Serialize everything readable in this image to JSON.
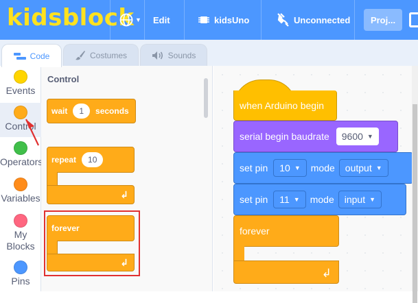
{
  "menubar": {
    "logo": "kidsblock",
    "edit_label": "Edit",
    "device_label": "kidsUno",
    "connection_label": "Unconnected",
    "project_label": "Proj..."
  },
  "tabs": [
    {
      "label": "Code"
    },
    {
      "label": "Costumes"
    },
    {
      "label": "Sounds"
    }
  ],
  "categories": [
    {
      "label": "Events",
      "color": "#ffd500"
    },
    {
      "label": "Control",
      "color": "#ffab19"
    },
    {
      "label": "Operators",
      "color": "#40bf4a"
    },
    {
      "label": "Variables",
      "color": "#ff8c1a"
    },
    {
      "label": "My Blocks",
      "color": "#ff6680"
    },
    {
      "label": "Pins",
      "color": "#4c97ff"
    }
  ],
  "palette": {
    "title": "Control",
    "wait": {
      "label": "wait",
      "value": "1",
      "suffix": "seconds"
    },
    "repeat": {
      "label": "repeat",
      "value": "10"
    },
    "forever": {
      "label": "forever"
    }
  },
  "script": {
    "hat": "when Arduino begin",
    "serial": {
      "label": "serial begin baudrate",
      "value": "9600"
    },
    "pin1": {
      "label": "set pin",
      "pin": "10",
      "mode_label": "mode",
      "mode": "output"
    },
    "pin2": {
      "label": "set pin",
      "pin": "11",
      "mode_label": "mode",
      "mode": "input"
    },
    "forever": "forever"
  }
}
